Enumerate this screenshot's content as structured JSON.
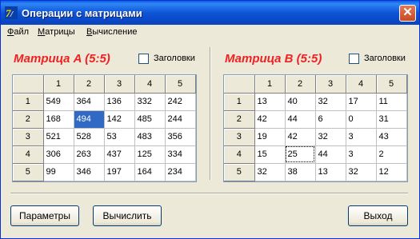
{
  "window": {
    "title": "Операции с матрицами",
    "close_symbol": "✕"
  },
  "menu": [
    {
      "label": "Файл",
      "hotkey": "Ф",
      "rest": "айл"
    },
    {
      "label": "Матрицы",
      "hotkey": "М",
      "rest": "атрицы"
    },
    {
      "label": "Вычисление",
      "hotkey": "В",
      "rest": "ычисление"
    }
  ],
  "matrixA": {
    "title": "Матрица A (5:5)",
    "headers_label": "Заголовки",
    "headers_checked": false,
    "col_headers": [
      "1",
      "2",
      "3",
      "4",
      "5"
    ],
    "row_headers": [
      "1",
      "2",
      "3",
      "4",
      "5"
    ],
    "rows": [
      [
        "549",
        "364",
        "136",
        "332",
        "242"
      ],
      [
        "168",
        "494",
        "142",
        "485",
        "244"
      ],
      [
        "521",
        "528",
        "53",
        "483",
        "356"
      ],
      [
        "306",
        "263",
        "437",
        "125",
        "334"
      ],
      [
        "99",
        "346",
        "197",
        "164",
        "234"
      ]
    ],
    "selected_cell": "row 2, col 2"
  },
  "matrixB": {
    "title": "Матрица B (5:5)",
    "headers_label": "Заголовки",
    "headers_checked": false,
    "col_headers": [
      "1",
      "2",
      "3",
      "4",
      "5"
    ],
    "row_headers": [
      "1",
      "2",
      "3",
      "4",
      "5"
    ],
    "rows": [
      [
        "13",
        "40",
        "32",
        "17",
        "11"
      ],
      [
        "42",
        "44",
        "6",
        "0",
        "31"
      ],
      [
        "19",
        "42",
        "32",
        "3",
        "43"
      ],
      [
        "15",
        "25",
        "44",
        "3",
        "2"
      ],
      [
        "32",
        "38",
        "13",
        "32",
        "12"
      ]
    ],
    "focused_cell": "row 4, col 2"
  },
  "buttons": {
    "params": "Параметры",
    "calc": "Вычислить",
    "exit": "Выход"
  },
  "colors": {
    "title_red": "#ee2222",
    "selection": "#316ac5",
    "titlebar": "#0a48c9"
  }
}
